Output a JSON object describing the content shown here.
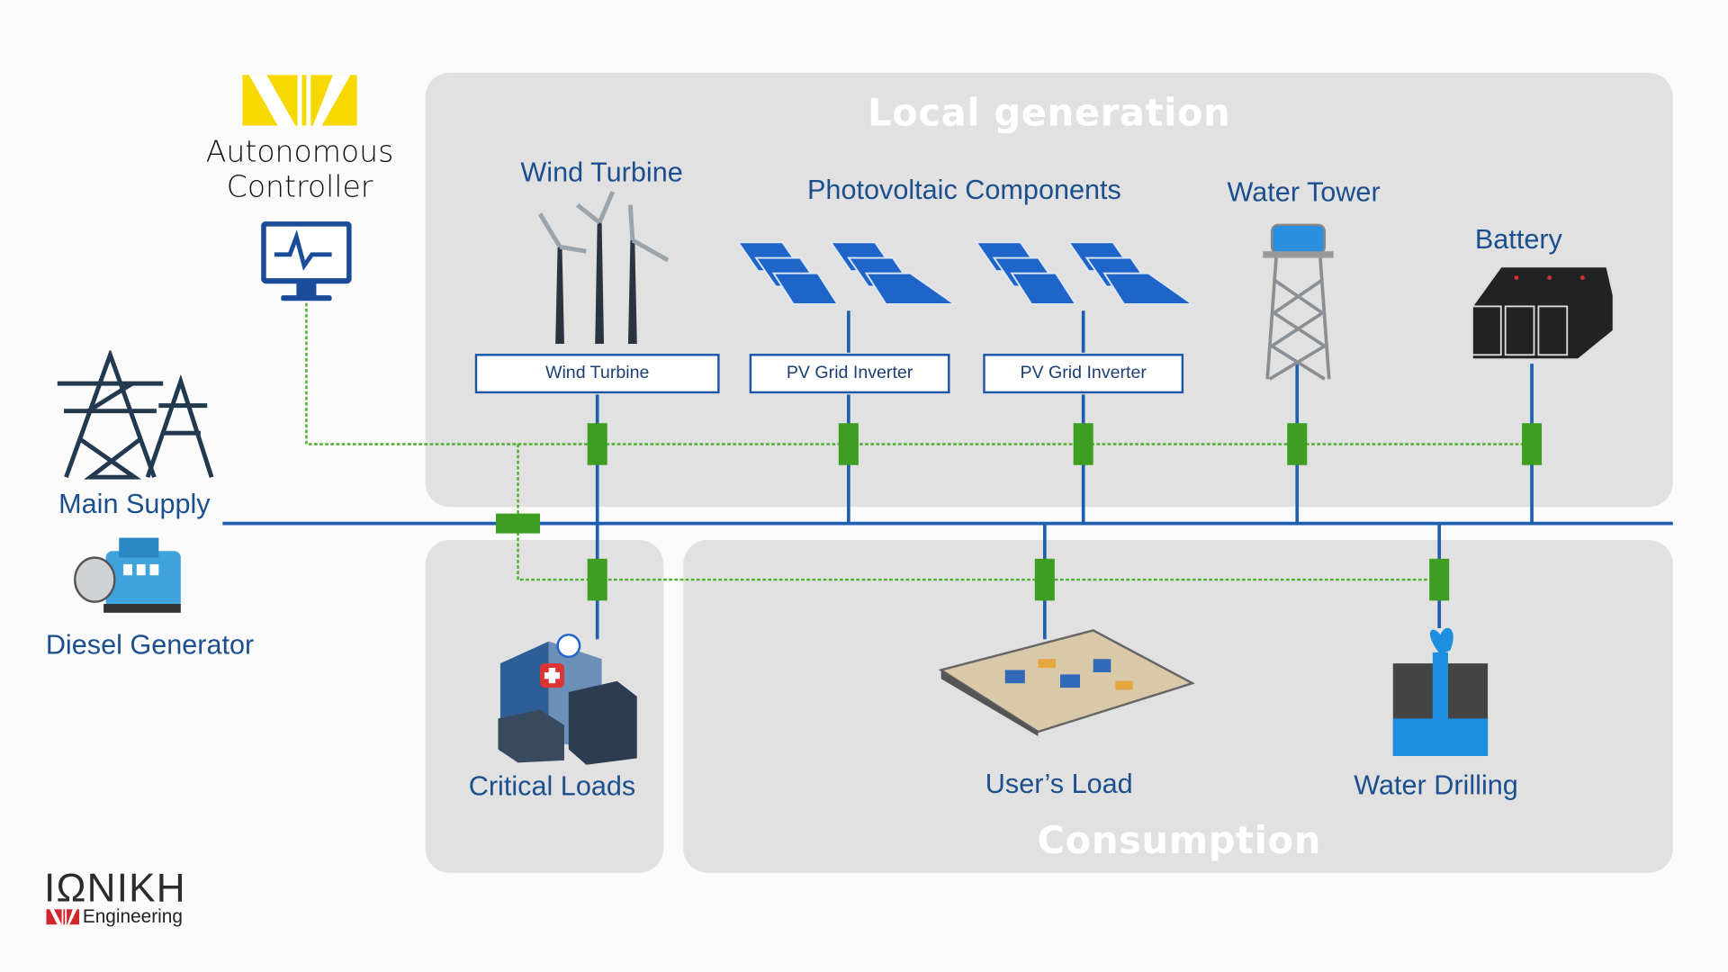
{
  "panels": {
    "local_generation": "Local generation",
    "consumption": "Consumption"
  },
  "controller": {
    "line1": "Autonomous",
    "line2": "Controller",
    "icon": "monitor-pulse-icon"
  },
  "sources": {
    "main_supply": "Main Supply",
    "diesel_generator": "Diesel Generator"
  },
  "generation": {
    "wind_turbine": "Wind Turbine",
    "photovoltaic": "Photovoltaic Components",
    "water_tower": "Water Tower",
    "battery": "Battery"
  },
  "boxes": [
    "Wind Turbine",
    "PV Grid Inverter",
    "PV Grid Inverter"
  ],
  "loads": {
    "critical": "Critical Loads",
    "users": "User’s Load",
    "water_drilling": "Water Drilling"
  },
  "brand": {
    "name": "ΙΩΝΙΚΗ",
    "sub": "Engineering"
  },
  "colors": {
    "bus": "#1f5fb0",
    "control": "#4caf2a",
    "panel": "#e1e1e1",
    "label": "#1c4f8e",
    "logo_yellow": "#f7d800",
    "logo_red": "#d0262e"
  }
}
